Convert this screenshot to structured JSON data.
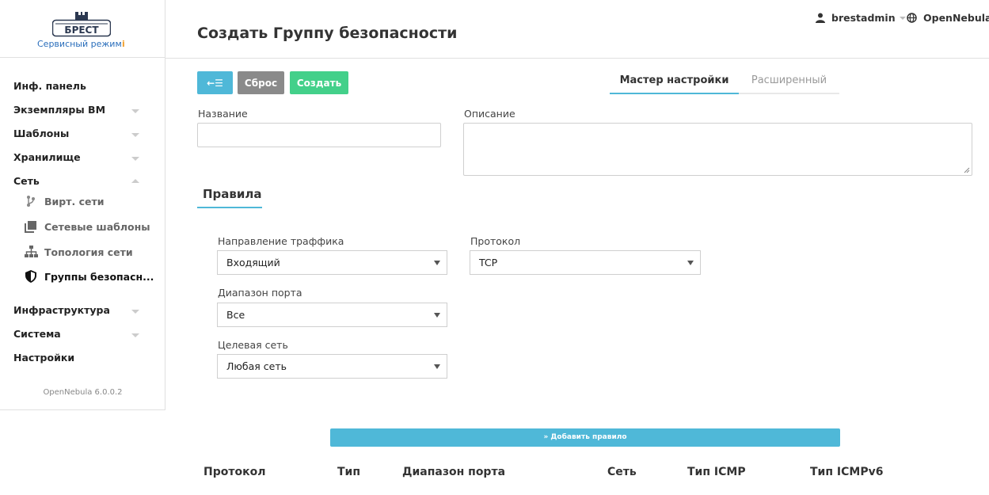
{
  "sidebar": {
    "logo_text": "БРЕСТ",
    "mode": "Сервисный режим",
    "mode_info": "i",
    "items": [
      {
        "label": "Инф. панель"
      },
      {
        "label": "Экземпляры ВМ"
      },
      {
        "label": "Шаблоны"
      },
      {
        "label": "Хранилище"
      },
      {
        "label": "Сеть"
      },
      {
        "label": "Инфраструктура"
      },
      {
        "label": "Система"
      },
      {
        "label": "Настройки"
      }
    ],
    "network_sub": [
      {
        "label": "Вирт. сети",
        "icon": "branch-icon"
      },
      {
        "label": "Сетевые шаблоны",
        "icon": "copy-icon"
      },
      {
        "label": "Топология сети",
        "icon": "sitemap-icon"
      },
      {
        "label": "Группы безопасн...",
        "icon": "shield-icon"
      }
    ],
    "version": "OpenNebula 6.0.0.2"
  },
  "header": {
    "title": "Создать Группу безопасности",
    "user": "brestadmin",
    "zone": "OpenNebula"
  },
  "toolbar": {
    "back_icon": "←☰",
    "reset_label": "Сброс",
    "create_label": "Создать"
  },
  "tabs": {
    "wizard": "Мастер настройки",
    "advanced": "Расширенный"
  },
  "form": {
    "name_label": "Название",
    "name_value": "",
    "description_label": "Описание",
    "description_value": ""
  },
  "rules": {
    "tab_label": "Правила",
    "direction_label": "Направление траффика",
    "direction_value": "Входящий",
    "protocol_label": "Протокол",
    "protocol_value": "TCP",
    "port_range_label": "Диапазон порта",
    "port_range_value": "Все",
    "target_label": "Целевая сеть",
    "target_value": "Любая сеть",
    "add_button": "» Добавить правило"
  },
  "table": {
    "columns": [
      "Протокол",
      "Тип",
      "Диапазон порта",
      "Сеть",
      "Тип ICMP",
      "Тип ICMPv6"
    ]
  },
  "colors": {
    "accent": "#4fb8d8",
    "reset": "#8a8a8a",
    "create": "#43d08a"
  }
}
